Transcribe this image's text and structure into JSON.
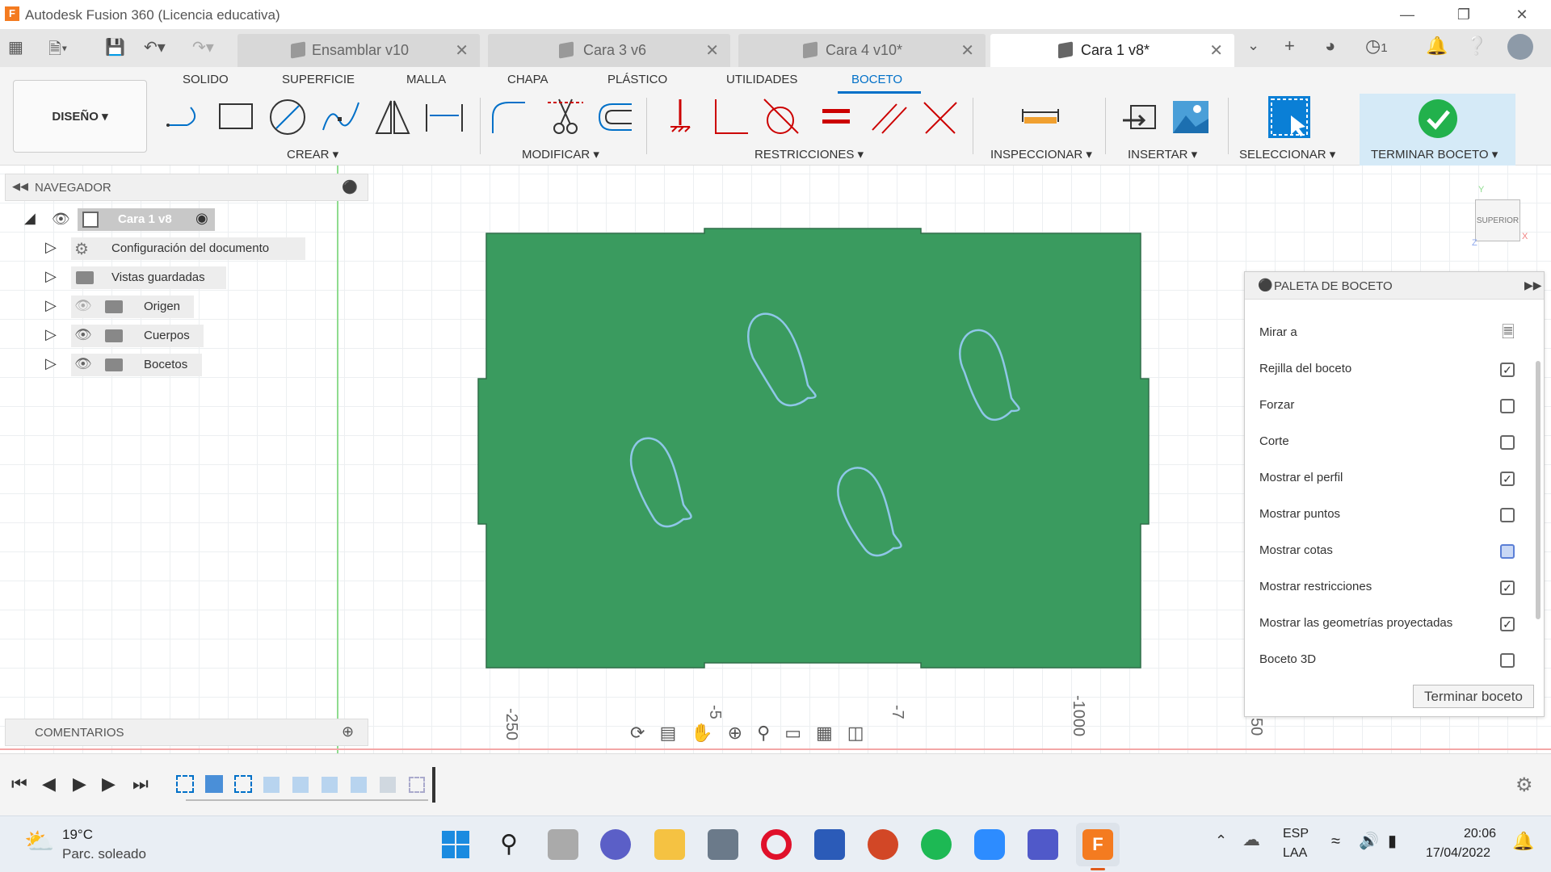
{
  "window": {
    "title": "Autodesk Fusion 360 (Licencia educativa)",
    "logo_letter": "F"
  },
  "doc_tabs": [
    {
      "label": "Ensamblar v10",
      "active": false
    },
    {
      "label": "Cara 3 v6",
      "active": false
    },
    {
      "label": "Cara 4 v10*",
      "active": false
    },
    {
      "label": "Cara 1 v8*",
      "active": true
    }
  ],
  "tabbar_right": {
    "jobs_count": "1"
  },
  "menu_tabs": [
    "SOLIDO",
    "SUPERFICIE",
    "MALLA",
    "CHAPA",
    "PLÁSTICO",
    "UTILIDADES",
    "BOCETO"
  ],
  "active_menu_tab": "BOCETO",
  "workspace": "DISEÑO",
  "tool_groups": {
    "crear": "CREAR",
    "modificar": "MODIFICAR",
    "restricciones": "RESTRICCIONES",
    "inspeccionar": "INSPECCIONAR",
    "insertar": "INSERTAR",
    "seleccionar": "SELECCIONAR",
    "terminar": "TERMINAR BOCETO"
  },
  "navigator": {
    "title": "NAVEGADOR",
    "root": "Cara 1 v8",
    "items": [
      "Configuración del documento",
      "Vistas guardadas",
      "Origen",
      "Cuerpos",
      "Bocetos"
    ]
  },
  "comments": {
    "title": "COMENTARIOS"
  },
  "viewcube": {
    "face": "SUPERIOR",
    "axis_x": "X",
    "axis_y": "Y",
    "axis_z": "Z"
  },
  "ruler": [
    "-250",
    "-5",
    "-7",
    "-1000",
    "50"
  ],
  "palette": {
    "title": "PALETA DE BOCETO",
    "look_at": "Mirar a",
    "options": [
      {
        "label": "Rejilla del boceto",
        "checked": true
      },
      {
        "label": "Forzar",
        "checked": false
      },
      {
        "label": "Corte",
        "checked": false
      },
      {
        "label": "Mostrar el perfil",
        "checked": true
      },
      {
        "label": "Mostrar puntos",
        "checked": false
      },
      {
        "label": "Mostrar cotas",
        "checked": false
      },
      {
        "label": "Mostrar restricciones",
        "checked": true
      },
      {
        "label": "Mostrar las geometrías proyectadas",
        "checked": true
      },
      {
        "label": "Boceto 3D",
        "checked": false
      }
    ],
    "finish_button": "Terminar boceto"
  },
  "taskbar": {
    "weather_temp": "19°C",
    "weather_desc": "Parc. soleado",
    "lang_top": "ESP",
    "lang_bottom": "LAA",
    "time": "20:06",
    "date": "17/04/2022"
  },
  "colors": {
    "accent": "#0070c8",
    "sketch_fill": "#3a9b5f",
    "profile_line": "#8fc7e8",
    "finish_green": "#22b14c"
  }
}
